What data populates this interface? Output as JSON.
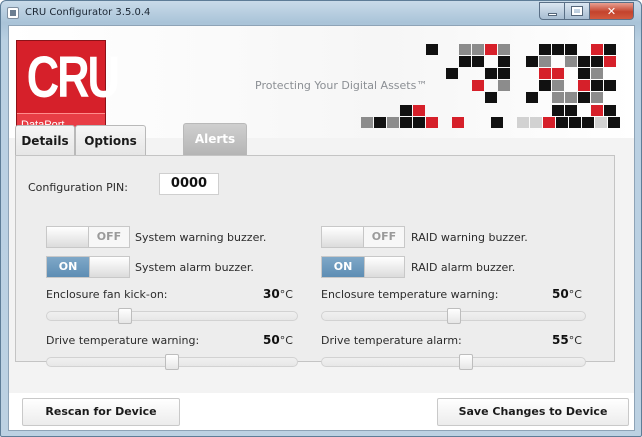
{
  "window": {
    "title": "CRU Configurator 3.5.0.4",
    "caption_buttons": [
      "minimize-icon",
      "maximize-icon",
      "close-icon"
    ],
    "close_glyph": "✕"
  },
  "banner": {
    "logo_text": "CRU",
    "logo_subtext": "DataPort",
    "tagline": "Protecting Your Digital Assets™",
    "colors": {
      "brand_red": "#d6202a",
      "pixel_black": "#111111",
      "pixel_gray": "#8c8c8c",
      "pixel_light": "#d2d2d2"
    }
  },
  "tabs": [
    {
      "label": "Details",
      "selected": false
    },
    {
      "label": "Options",
      "selected": false
    },
    {
      "label": "Alerts",
      "selected": true
    }
  ],
  "alerts": {
    "pin_label": "Configuration PIN:",
    "pin_value": "0000",
    "toggles": {
      "system_warning": {
        "state": "OFF",
        "label": "System warning buzzer."
      },
      "raid_warning": {
        "state": "OFF",
        "label": "RAID warning buzzer."
      },
      "system_alarm": {
        "state": "ON",
        "label": "System alarm buzzer."
      },
      "raid_alarm": {
        "state": "ON",
        "label": "RAID alarm buzzer."
      }
    },
    "sliders": {
      "fan_kickon": {
        "label": "Enclosure fan kick-on:",
        "value": "30",
        "unit": "°C",
        "fraction": 0.3
      },
      "enclosure_temp_warning": {
        "label": "Enclosure temperature warning:",
        "value": "50",
        "unit": "°C",
        "fraction": 0.5
      },
      "drive_temp_warning": {
        "label": "Drive temperature warning:",
        "value": "50",
        "unit": "°C",
        "fraction": 0.5
      },
      "drive_temp_alarm": {
        "label": "Drive temperature alarm:",
        "value": "55",
        "unit": "°C",
        "fraction": 0.55
      }
    }
  },
  "footer": {
    "rescan_label": "Rescan for Device",
    "save_label": "Save Changes to Device"
  }
}
